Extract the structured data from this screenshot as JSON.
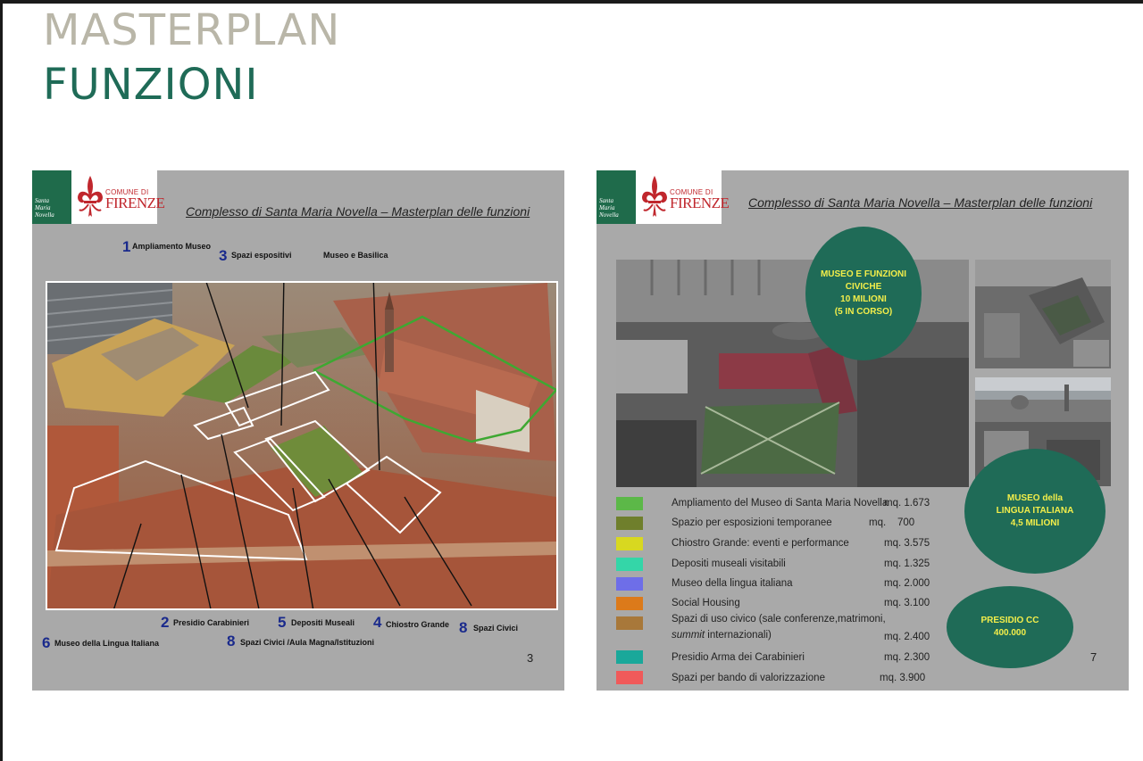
{
  "page": {
    "title_line1": "MASTERPLAN",
    "title_line2": "FUNZIONI"
  },
  "logo": {
    "sidebar_text": [
      "Santa",
      "Maria",
      "Novella"
    ],
    "comune": "COMUNE DI",
    "city": "FIRENZE"
  },
  "slide1": {
    "title": "Complesso di Santa Maria Novella – Masterplan delle funzioni",
    "page_number": "3",
    "labels": [
      {
        "num": "1",
        "text": "Ampliamento Museo"
      },
      {
        "num": "3",
        "text": "Spazi espositivi"
      },
      {
        "num": "",
        "text": "Museo e Basilica"
      },
      {
        "num": "2",
        "text": "Presidio Carabinieri"
      },
      {
        "num": "5",
        "text": "Depositi Museali"
      },
      {
        "num": "4",
        "text": "Chiostro Grande"
      },
      {
        "num": "8",
        "text": "Spazi Civici"
      },
      {
        "num": "6",
        "text": "Museo della Lingua Italiana"
      },
      {
        "num": "8",
        "text": "Spazi Civici /Aula Magna/Istituzioni"
      }
    ]
  },
  "slide2": {
    "title": "Complesso di Santa Maria Novella – Masterplan delle funzioni",
    "page_number": "7",
    "circles": [
      {
        "lines": [
          "MUSEO E FUNZIONI",
          "CIVICHE",
          "10 MILIONI",
          "(5 IN CORSO)"
        ]
      },
      {
        "lines": [
          "MUSEO della",
          "LINGUA ITALIANA",
          "4,5 MILIONI"
        ]
      },
      {
        "lines": [
          "PRESIDIO  CC",
          "400.000"
        ]
      }
    ],
    "legend": [
      {
        "color": "#5cb848",
        "label": "Ampliamento del Museo di Santa Maria Novella",
        "value": "mq. 1.673"
      },
      {
        "color": "#6f7f2c",
        "label": "Spazio per esposizioni temporanee",
        "value": "mq.    700"
      },
      {
        "color": "#d8d820",
        "label": "Chiostro Grande: eventi e performance",
        "value": "mq. 3.575"
      },
      {
        "color": "#34d6a8",
        "label": "Depositi museali visitabili",
        "value": "mq. 1.325"
      },
      {
        "color": "#6e6ee8",
        "label": "Museo della lingua italiana",
        "value": "mq. 2.000"
      },
      {
        "color": "#dc7a1a",
        "label": "Social Housing",
        "value": "mq. 3.100"
      },
      {
        "color": "#a8783a",
        "label": "Spazi di uso civico (sale conferenze,matrimoni,",
        "label2": "summit internazionali)",
        "value": "mq. 2.400"
      },
      {
        "color": "#1aa89a",
        "label": "Presidio Arma dei Carabinieri",
        "value": "mq. 2.300"
      },
      {
        "color": "#f05a5a",
        "label": "Spazi per bando di valorizzazione",
        "value": "mq. 3.900"
      }
    ]
  }
}
